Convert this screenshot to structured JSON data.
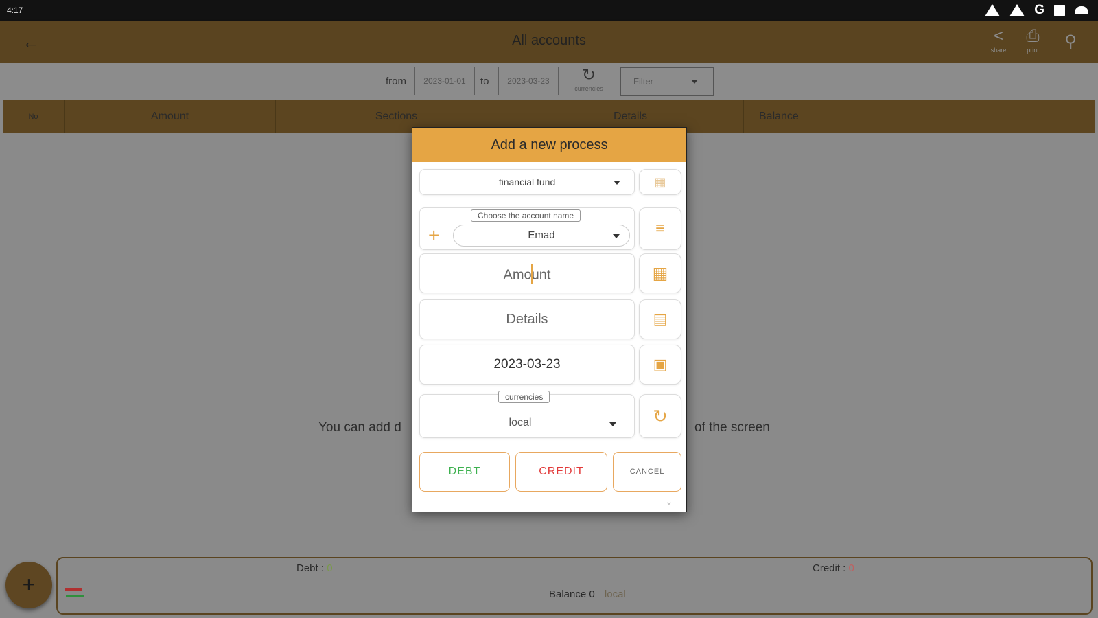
{
  "statusbar": {
    "time": "4:17"
  },
  "appbar": {
    "title": "All accounts",
    "share_label": "share",
    "print_label": "print"
  },
  "filters": {
    "from_label": "from",
    "from_date": "2023-01-01",
    "to_label": "to",
    "to_date": "2023-03-23",
    "currencies_label": "currencies",
    "filter_placeholder": "Filter"
  },
  "table": {
    "columns": [
      "No",
      "Amount",
      "Sections",
      "Details",
      "Balance"
    ]
  },
  "empty_message": {
    "left": "You can add d",
    "right": "of the screen"
  },
  "summary": {
    "debt_label": "Debt :",
    "debt_value": "0",
    "credit_label": "Credit :",
    "credit_value": "0",
    "balance_label": "Balance 0",
    "balance_currency": "local"
  },
  "dialog": {
    "title": "Add a new process",
    "section_select": "financial fund",
    "account_label": "Choose the account name",
    "account_value": "Emad",
    "amount_placeholder_a": "Amo",
    "amount_placeholder_b": "unt",
    "details_placeholder": "Details",
    "date_value": "2023-03-23",
    "currency_label": "currencies",
    "currency_value": "local",
    "debt_button": "DEBT",
    "credit_button": "CREDIT",
    "cancel_button": "CANCEL"
  },
  "colors": {
    "accent": "#e5a544",
    "appbar_dimmed": "#5a4420",
    "debt_green": "#3db14f",
    "credit_red": "#e23a3a"
  }
}
